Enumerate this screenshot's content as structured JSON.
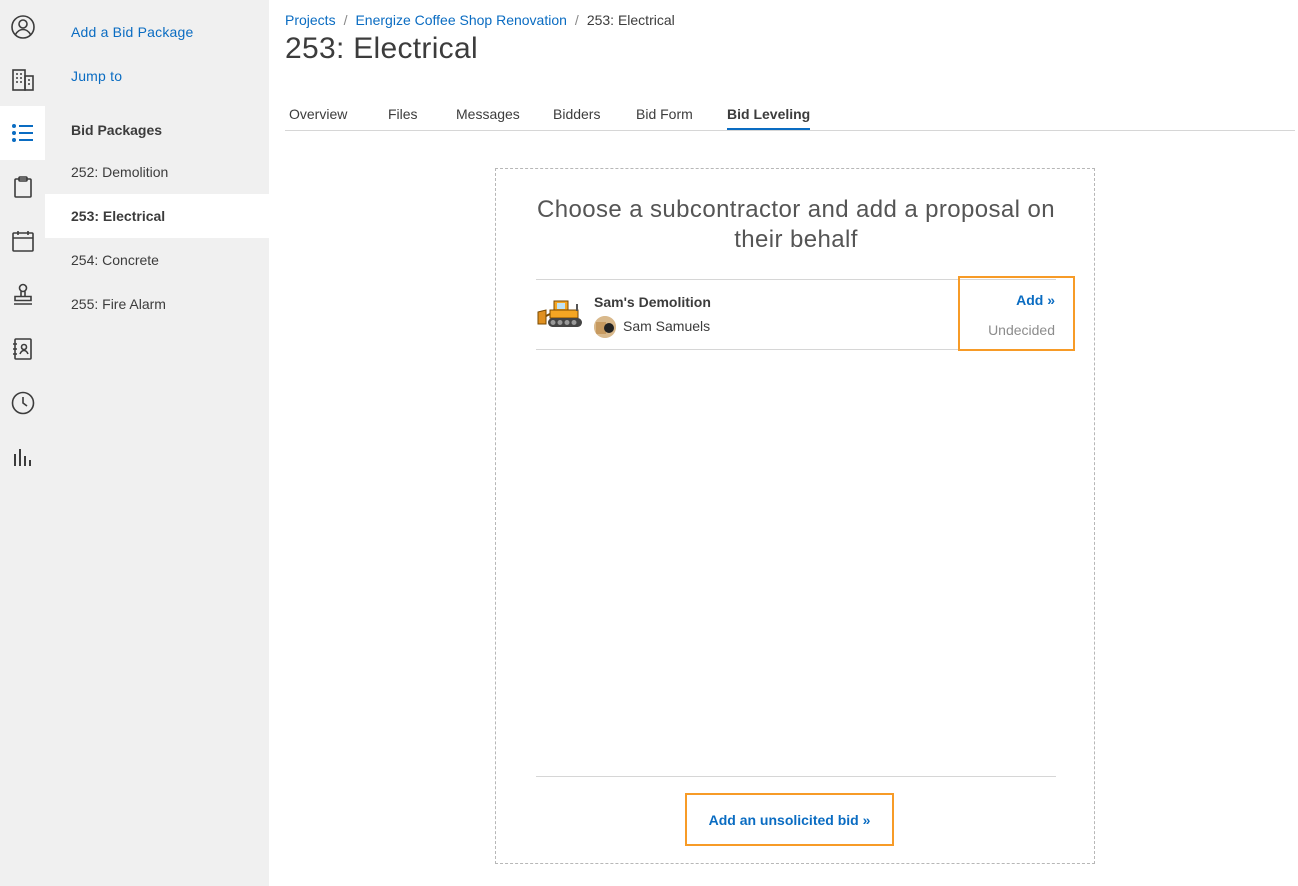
{
  "sidenav": {
    "add_bid_package": "Add a Bid Package",
    "jump_to": "Jump to",
    "heading": "Bid Packages",
    "packages": [
      {
        "label": "252: Demolition"
      },
      {
        "label": "253: Electrical"
      },
      {
        "label": "254: Concrete"
      },
      {
        "label": "255: Fire Alarm"
      }
    ]
  },
  "rail_icons": [
    "user-circle-icon",
    "building-icon",
    "list-icon",
    "clipboard-icon",
    "calendar-icon",
    "stamp-icon",
    "contacts-book-icon",
    "clock-icon",
    "bar-chart-icon"
  ],
  "breadcrumb": {
    "projects": "Projects",
    "separator": "/",
    "project": "Energize Coffee Shop Renovation",
    "current": "253: Electrical"
  },
  "page": {
    "title": "253: Electrical"
  },
  "tabs": [
    {
      "label": "Overview"
    },
    {
      "label": "Files"
    },
    {
      "label": "Messages"
    },
    {
      "label": "Bidders"
    },
    {
      "label": "Bid Form"
    },
    {
      "label": "Bid Leveling"
    }
  ],
  "panel": {
    "heading": "Choose a subcontractor and add a proposal on their behalf",
    "subcontractor": {
      "name": "Sam's Demolition",
      "contact": "Sam Samuels",
      "add_label": "Add »",
      "status": "Undecided"
    },
    "unsolicited_label": "Add an unsolicited bid »"
  },
  "colors": {
    "link": "#0a6cc2",
    "highlight": "#f79b27",
    "rail_bg": "#f0f0f0",
    "rail_icon": "#3c3c3c",
    "rail_icon_active": "#0a6cc2"
  }
}
